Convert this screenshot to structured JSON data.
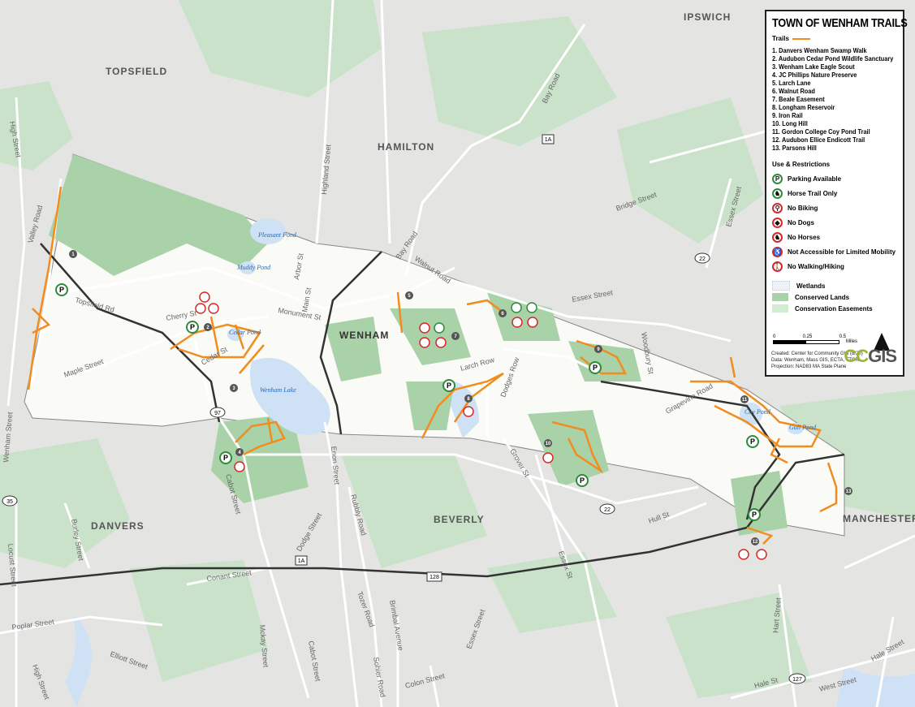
{
  "legend": {
    "title": "TOWN OF WENHAM TRAILS",
    "trails_heading": "Trails",
    "trails": [
      "1. Danvers Wenham Swamp Walk",
      "2. Audubon Cedar Pond Wildlife Sanctuary",
      "3. Wenham Lake Eagle Scout",
      "4. JC Phillips Nature Preserve",
      "5. Larch Lane",
      "6. Walnut Road",
      "7. Beale Easement",
      "8. Longham Reservoir",
      "9. Iron Rail",
      "10. Long Hill",
      "11. Gordon College Coy Pond Trail",
      "12. Audubon Ellice Endicott Trail",
      "13. Parsons Hill"
    ],
    "use_heading": "Use & Restrictions",
    "uses": [
      {
        "icon": "parking-icon",
        "glyph": "P",
        "label": "Parking Available",
        "color": "#2e8b3e"
      },
      {
        "icon": "horse-icon",
        "glyph": "♞",
        "label": "Horse Trail Only",
        "color": "#2e8b3e"
      },
      {
        "icon": "no-biking-icon",
        "glyph": "⚲",
        "label": "No Biking",
        "color": "#d62828"
      },
      {
        "icon": "no-dogs-icon",
        "glyph": "◆",
        "label": "No Dogs",
        "color": "#d62828"
      },
      {
        "icon": "no-horses-icon",
        "glyph": "♞",
        "label": "No Horses",
        "color": "#d62828"
      },
      {
        "icon": "no-wheelchair-icon",
        "glyph": "♿",
        "label": "Not Accessible for Limited Mobility",
        "color": "#d62828"
      },
      {
        "icon": "no-hiking-icon",
        "glyph": "🚶",
        "label": "No Walking/Hiking",
        "color": "#d62828"
      }
    ],
    "land": [
      {
        "label": "Wetlands",
        "color": "#eef2f6"
      },
      {
        "label": "Conserved Lands",
        "color": "#a9d2a9"
      },
      {
        "label": "Conservation Easements",
        "color": "#d3ead3"
      }
    ],
    "scale": {
      "ticks": [
        "0",
        "0.25",
        "0.5"
      ],
      "unit": "Miles"
    },
    "credits": [
      "Created: Center for Community GIS (8/20)",
      "Data: Wenham, Mass GIS, ECTA, TTOR",
      "Projection: NAD83 MA State Plane"
    ],
    "logo": {
      "a": "CC",
      "b": "GIS"
    }
  },
  "towns": [
    "TOPSFIELD",
    "HAMILTON",
    "IPSWICH",
    "WENHAM",
    "DANVERS",
    "BEVERLY",
    "MANCHESTER"
  ],
  "roads": [
    "High Street",
    "Valley Road",
    "Topsfield Rd",
    "Cherry St",
    "Monument St",
    "Main St",
    "Arbor St",
    "Highland Street",
    "Bay Road",
    "Walnut Road",
    "Essex Street",
    "Woodbury St",
    "Bridge Street",
    "Essex Street",
    "Maple Street",
    "Cedar St",
    "Larch Row",
    "Dodges Row",
    "Grapevine Road",
    "Wenham Street",
    "Burley Street",
    "Locust Street",
    "Poplar Street",
    "Elliott Street",
    "High Street",
    "Conant Street",
    "Cabot Street",
    "Dodge Street",
    "Rubbly Road",
    "Tozer Road",
    "Brimbal Avenue",
    "Mckay Street",
    "Sohier Road",
    "Colon Street",
    "Essex St",
    "Grover St",
    "Hull St",
    "Hart Street",
    "Hale St",
    "West Street",
    "Hale Street",
    "Enon Street",
    "Bay Road",
    "Essex Street",
    "Cabot Street"
  ],
  "water": [
    "Pleasant Pond",
    "Muddy Pond",
    "Cedar Pond",
    "Wenham Lake",
    "Coy Pond",
    "Gull Pond"
  ],
  "shields": [
    "1A",
    "97",
    "22",
    "35",
    "128",
    "127",
    "1A",
    "22"
  ],
  "trail_markers": [
    "1",
    "2",
    "3",
    "4",
    "5",
    "6",
    "7",
    "8",
    "9",
    "10",
    "11",
    "12",
    "13"
  ]
}
